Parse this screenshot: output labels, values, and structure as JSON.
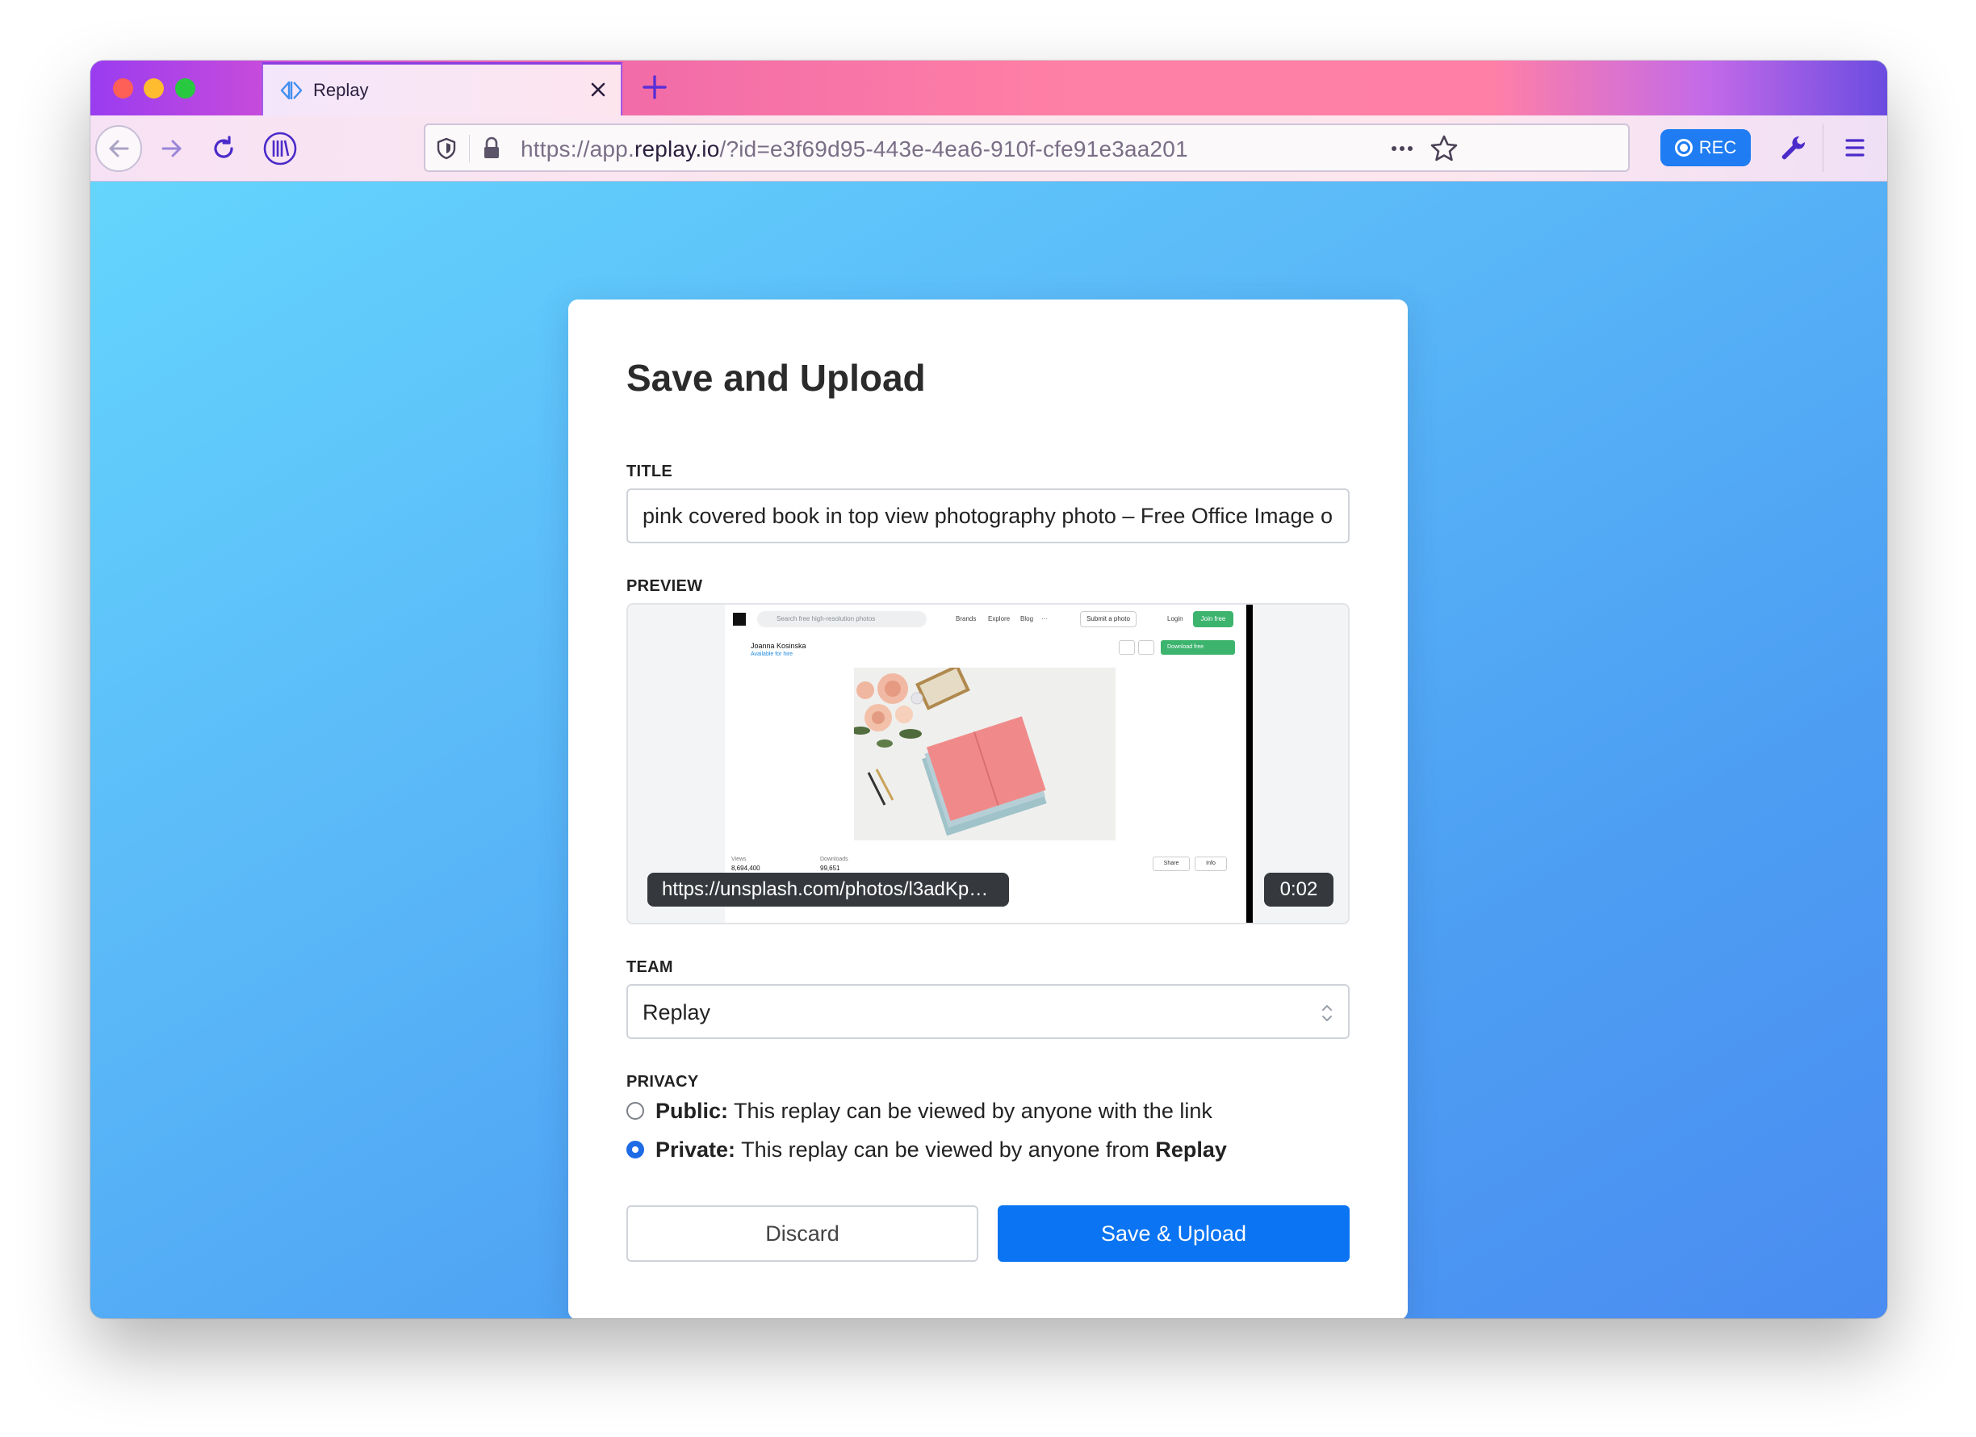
{
  "browser": {
    "tab": {
      "title": "Replay",
      "icon": "replay-logo-icon"
    },
    "new_tab_icon": "plus-icon",
    "url": {
      "prefix": "https://app.",
      "host": "replay.io",
      "rest": "/?id=e3f69d95-443e-4ea6-910f-cfe91e3aa201"
    },
    "rec_label": "REC",
    "toolbar_icons": [
      "back-arrow-icon",
      "forward-arrow-icon",
      "reload-icon",
      "library-icon",
      "shield-icon",
      "lock-icon",
      "more-dots-icon",
      "star-icon",
      "wrench-icon",
      "hamburger-menu-icon"
    ]
  },
  "dialog": {
    "title": "Save and Upload",
    "title_label": "TITLE",
    "title_value": "pink covered book in top view photography photo – Free Office Image o",
    "preview_label": "PREVIEW",
    "preview": {
      "url": "https://unsplash.com/photos/l3adKp…",
      "time": "0:02",
      "thumbnail": {
        "search_placeholder": "Search free high-resolution photos",
        "nav": [
          "Brands",
          "Explore",
          "Blog",
          "···"
        ],
        "submit": "Submit a photo",
        "login": "Login",
        "join": "Join free",
        "author": "Joanna Kosinska",
        "hire": "Available for hire",
        "download": "Download free",
        "views_label": "Views",
        "views_value": "8,694,400",
        "downloads_label": "Downloads",
        "downloads_value": "99,651",
        "share": "Share",
        "info": "Info"
      }
    },
    "team_label": "TEAM",
    "team_value": "Replay",
    "privacy_label": "PRIVACY",
    "privacy": {
      "public_title": "Public:",
      "public_desc": " This replay can be viewed by anyone with the link",
      "private_title": "Private:",
      "private_desc": " This replay can be viewed by anyone from ",
      "private_team": "Replay",
      "selected": "private"
    },
    "discard_label": "Discard",
    "save_label": "Save & Upload"
  },
  "colors": {
    "primary": "#0a74f2",
    "rec": "#1f7cf2"
  }
}
